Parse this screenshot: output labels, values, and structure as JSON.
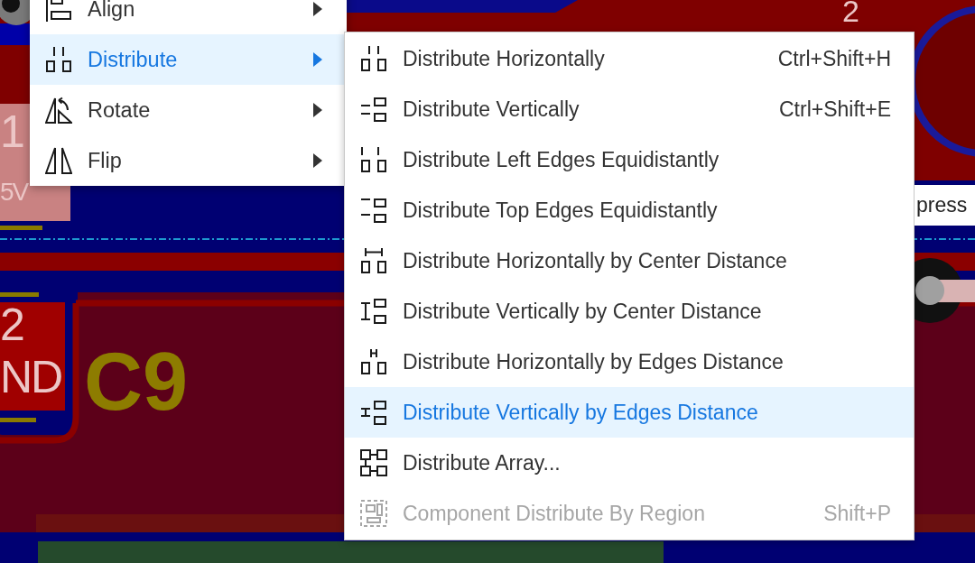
{
  "pcb": {
    "labels": [
      {
        "text": "2",
        "kind": "pad"
      },
      {
        "text": "1",
        "kind": "pad"
      },
      {
        "text": "5V",
        "kind": "pad"
      },
      {
        "text": "2",
        "kind": "pad"
      },
      {
        "text": "ND",
        "kind": "pad"
      },
      {
        "text": "C9",
        "kind": "silkscreen"
      }
    ]
  },
  "context_menu": {
    "items": [
      {
        "label": "Align",
        "selected": false,
        "has_submenu": true
      },
      {
        "label": "Distribute",
        "selected": true,
        "has_submenu": true
      },
      {
        "label": "Rotate",
        "selected": false,
        "has_submenu": true
      },
      {
        "label": "Flip",
        "selected": false,
        "has_submenu": true
      }
    ]
  },
  "submenu": {
    "items": [
      {
        "label": "Distribute Horizontally",
        "shortcut": "Ctrl+Shift+H",
        "selected": false,
        "disabled": false
      },
      {
        "label": "Distribute Vertically",
        "shortcut": "Ctrl+Shift+E",
        "selected": false,
        "disabled": false
      },
      {
        "label": "Distribute Left Edges Equidistantly",
        "selected": false,
        "disabled": false
      },
      {
        "label": "Distribute Top Edges Equidistantly",
        "selected": false,
        "disabled": false
      },
      {
        "label": "Distribute Horizontally by Center Distance",
        "selected": false,
        "disabled": false
      },
      {
        "label": "Distribute Vertically by Center Distance",
        "selected": false,
        "disabled": false
      },
      {
        "label": "Distribute Horizontally by Edges Distance",
        "selected": false,
        "disabled": false
      },
      {
        "label": "Distribute Vertically by Edges Distance",
        "selected": true,
        "disabled": false
      },
      {
        "label": "Distribute Array...",
        "selected": false,
        "disabled": false
      },
      {
        "label": "Component Distribute By Region",
        "shortcut": "Shift+P",
        "selected": false,
        "disabled": true
      }
    ]
  },
  "tooltip": {
    "text": "press"
  }
}
